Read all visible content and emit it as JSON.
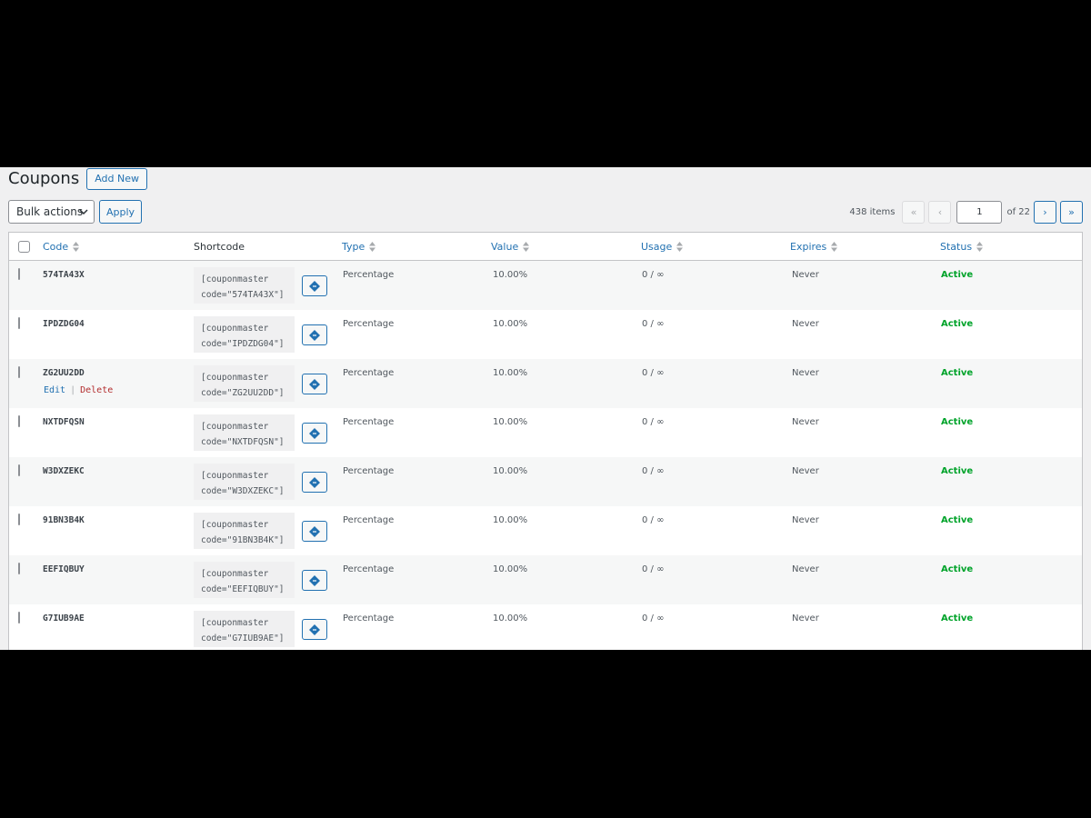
{
  "page": {
    "title": "Coupons",
    "add_new_label": "Add New"
  },
  "toolbar": {
    "bulk_actions_label": "Bulk actions",
    "apply_label": "Apply"
  },
  "pagination": {
    "items_count": "438 items",
    "first": "«",
    "prev": "‹",
    "current_page": "1",
    "of_label": "of 22",
    "next": "›",
    "last": "»"
  },
  "table": {
    "columns": {
      "code": "Code",
      "shortcode": "Shortcode",
      "type": "Type",
      "value": "Value",
      "usage": "Usage",
      "expires": "Expires",
      "status": "Status"
    },
    "row_actions": {
      "edit": "Edit",
      "separator": "|",
      "delete": "Delete"
    },
    "rows": [
      {
        "code": "574TA43X",
        "shortcode_line1": "[couponmaster",
        "shortcode_line2": "code=\"574TA43X\"]",
        "type": "Percentage",
        "value": "10.00%",
        "usage": "0 / ∞",
        "expires": "Never",
        "status": "Active"
      },
      {
        "code": "IPDZDG04",
        "shortcode_line1": "[couponmaster",
        "shortcode_line2": "code=\"IPDZDG04\"]",
        "type": "Percentage",
        "value": "10.00%",
        "usage": "0 / ∞",
        "expires": "Never",
        "status": "Active"
      },
      {
        "code": "ZG2UU2DD",
        "shortcode_line1": "[couponmaster",
        "shortcode_line2": "code=\"ZG2UU2DD\"]",
        "type": "Percentage",
        "value": "10.00%",
        "usage": "0 / ∞",
        "expires": "Never",
        "status": "Active"
      },
      {
        "code": "NXTDFQSN",
        "shortcode_line1": "[couponmaster",
        "shortcode_line2": "code=\"NXTDFQSN\"]",
        "type": "Percentage",
        "value": "10.00%",
        "usage": "0 / ∞",
        "expires": "Never",
        "status": "Active"
      },
      {
        "code": "W3DXZEKC",
        "shortcode_line1": "[couponmaster",
        "shortcode_line2": "code=\"W3DXZEKC\"]",
        "type": "Percentage",
        "value": "10.00%",
        "usage": "0 / ∞",
        "expires": "Never",
        "status": "Active"
      },
      {
        "code": "91BN3B4K",
        "shortcode_line1": "[couponmaster",
        "shortcode_line2": "code=\"91BN3B4K\"]",
        "type": "Percentage",
        "value": "10.00%",
        "usage": "0 / ∞",
        "expires": "Never",
        "status": "Active"
      },
      {
        "code": "EEFIQBUY",
        "shortcode_line1": "[couponmaster",
        "shortcode_line2": "code=\"EEFIQBUY\"]",
        "type": "Percentage",
        "value": "10.00%",
        "usage": "0 / ∞",
        "expires": "Never",
        "status": "Active"
      },
      {
        "code": "G7IUB9AE",
        "shortcode_line1": "[couponmaster",
        "shortcode_line2": "code=\"G7IUB9AE\"]",
        "type": "Percentage",
        "value": "10.00%",
        "usage": "0 / ∞",
        "expires": "Never",
        "status": "Active"
      }
    ]
  },
  "colors": {
    "accent": "#2271b1",
    "active_status": "#00a32a",
    "delete": "#b32d2e",
    "background": "#f0f0f1"
  },
  "icons": {
    "sort": "sort-arrows-icon",
    "copy": "copy-ticket-icon",
    "dropdown": "chevron-down-icon"
  }
}
